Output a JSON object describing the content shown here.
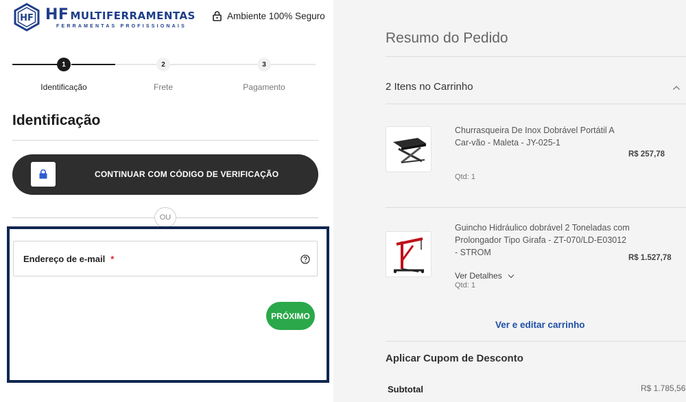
{
  "header": {
    "logo_hf": "HF",
    "logo_name": "MULTIFERRAMENTAS",
    "logo_tagline": "FERRAMENTAS PROFISSIONAIS",
    "secure_label": "Ambiente 100% Seguro"
  },
  "stepper": {
    "steps": [
      {
        "number": "1",
        "label": "Identificação",
        "active": true
      },
      {
        "number": "2",
        "label": "Frete",
        "active": false
      },
      {
        "number": "3",
        "label": "Pagamento",
        "active": false
      }
    ]
  },
  "identification": {
    "title": "Identificação",
    "verify_button": "CONTINUAR COM CÓDIGO DE VERIFICAÇÃO",
    "separator": "OU",
    "email_label": "Endereço de e-mail",
    "required_mark": "*",
    "next_button": "PRÓXIMO"
  },
  "summary": {
    "title": "Resumo do Pedido",
    "cart_header": "2 Itens no Carrinho",
    "items": [
      {
        "name": "Churrasqueira De Inox Dobrável Portátil A Car-vão - Maleta - JY-025-1",
        "price": "R$ 257,78",
        "qty": "Qtd: 1"
      },
      {
        "name": "Guincho Hidráulico dobrável 2 Toneladas com Prolongador Tipo Girafa - ZT-070/LD-E03012 - STROM",
        "price": "R$ 1.527,78",
        "qty": "Qtd: 1",
        "details": "Ver Detalhes"
      }
    ],
    "edit_cart": "Ver e editar carrinho",
    "coupon": "Aplicar Cupom de Desconto",
    "subtotal_label": "Subtotal",
    "subtotal_value": "R$ 1.785,56"
  },
  "colors": {
    "brand_blue": "#1f3e8a",
    "dark_button": "#2e2e2e",
    "next_green": "#2aa84a",
    "highlight_border": "#0f2650",
    "link_blue": "#1f4fa5"
  }
}
